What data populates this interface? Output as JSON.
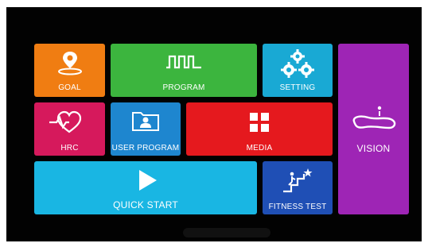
{
  "tiles": {
    "goal": {
      "label": "GOAL",
      "color": "#f07d12",
      "icon": "location-pin-icon"
    },
    "program": {
      "label": "PROGRAM",
      "color": "#3cb53e",
      "icon": "pulse-wave-icon"
    },
    "setting": {
      "label": "SETTING",
      "color": "#19a9d4",
      "icon": "gears-icon"
    },
    "vision": {
      "label": "VISION",
      "color": "#9e25b5",
      "icon": "track-icon"
    },
    "hrc": {
      "label": "HRC",
      "color": "#d6195c",
      "icon": "heart-rate-icon"
    },
    "user_program": {
      "label": "USER PROGRAM",
      "color": "#1e86cf",
      "icon": "user-folder-icon"
    },
    "media": {
      "label": "MEDIA",
      "color": "#e5191e",
      "icon": "grid-icon"
    },
    "quick_start": {
      "label": "QUICK START",
      "color": "#19b6e3",
      "icon": "play-icon"
    },
    "fitness_test": {
      "label": "FITNESS TEST",
      "color": "#1f4fb5",
      "icon": "stairs-star-icon"
    }
  }
}
